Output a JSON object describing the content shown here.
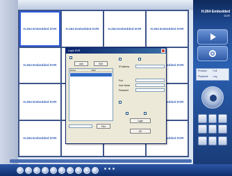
{
  "brand": {
    "line1": "H.264 Embedded",
    "line2": "DVR"
  },
  "channels": [
    "H.264 Embedded DVR",
    "H.264 Embedded DVR",
    "H.264 Embedded DVR",
    "H.264 Embedded DVR",
    "H.264 Embedded DVR",
    "H.264 Embedded DVR",
    "H.264 Embedded DVR",
    "H.264 Embedded DVR",
    "H.264 Embedded DVR",
    "H.264 Embedded DVR",
    "H.264 Embedded DVR",
    "H.264 Embedded DVR",
    "H.264 Embedded DVR",
    "H.264 Embedded DVR",
    "H.264 Embedded DVR",
    "H.264 Embedded DVR"
  ],
  "right_panel": {
    "buttons": [
      "play-icon",
      "settings-icon",
      "close-icon"
    ],
    "mini_labels": [
      "Preview",
      "Full",
      "Playback",
      "Log"
    ]
  },
  "dialog": {
    "title": "Login DVR",
    "add_label": "Add",
    "edit_label": "Edit",
    "list_headers": [
      "Name",
      "Addr"
    ],
    "find_label": "Find",
    "login_label": "Login",
    "save_label": "Save",
    "ok_label": "OK",
    "ip_label": "IP Address",
    "port_label": "Port",
    "user_label": "User Name",
    "password_label": "Password"
  },
  "colors": {
    "accent": "#2d5bd8",
    "panel": "#1c3d7a",
    "cell_text": "#3a63b8"
  }
}
